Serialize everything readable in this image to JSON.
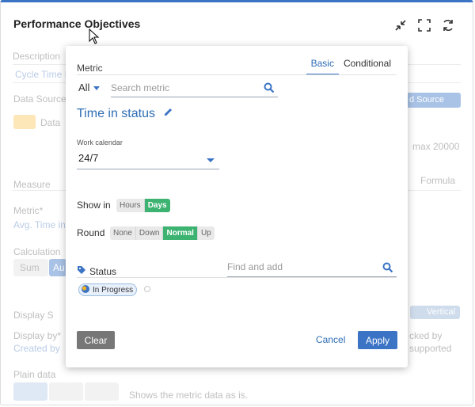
{
  "panel": {
    "title": "Performance Objectives"
  },
  "background": {
    "description_label": "Description",
    "description_value": "Cycle Time K",
    "data_source_label": "Data Source",
    "data_label": "Data",
    "add_source": "d Source",
    "max_text": "max 20000",
    "measure_label": "Measure",
    "formula_tab": "Formula",
    "metric_label": "Metric*",
    "metric_value": "Avg. Time in",
    "calculation_label": "Calculation",
    "sum_btn": "Sum",
    "au_btn": "Au",
    "display_label": "Display S",
    "vertical_btn": "Vertical",
    "display_by": "Display by*",
    "created_by": "Created by",
    "cked_by": "cked by",
    "supported": "supported",
    "plain_data": "Plain data",
    "shows_text": "Shows the metric data as is."
  },
  "popup": {
    "metric_label": "Metric",
    "tabs": [
      "Basic",
      "Conditional"
    ],
    "active_tab": "Basic",
    "filter_all": "All",
    "search_placeholder": "Search metric",
    "metric_title": "Time in status",
    "work_calendar_label": "Work calendar",
    "work_calendar_value": "24/7",
    "show_in_label": "Show in",
    "show_in_options": [
      "Hours",
      "Days"
    ],
    "show_in_selected": "Days",
    "round_label": "Round",
    "round_options": [
      "None",
      "Down",
      "Normal",
      "Up"
    ],
    "round_selected": "Normal",
    "status_label": "Status",
    "find_placeholder": "Find and add",
    "status_chip": "In Progress",
    "clear_label": "Clear",
    "cancel_label": "Cancel",
    "apply_label": "Apply"
  },
  "colors": {
    "accent": "#3b73c5",
    "success": "#3cb371",
    "button_gray": "#777777"
  }
}
